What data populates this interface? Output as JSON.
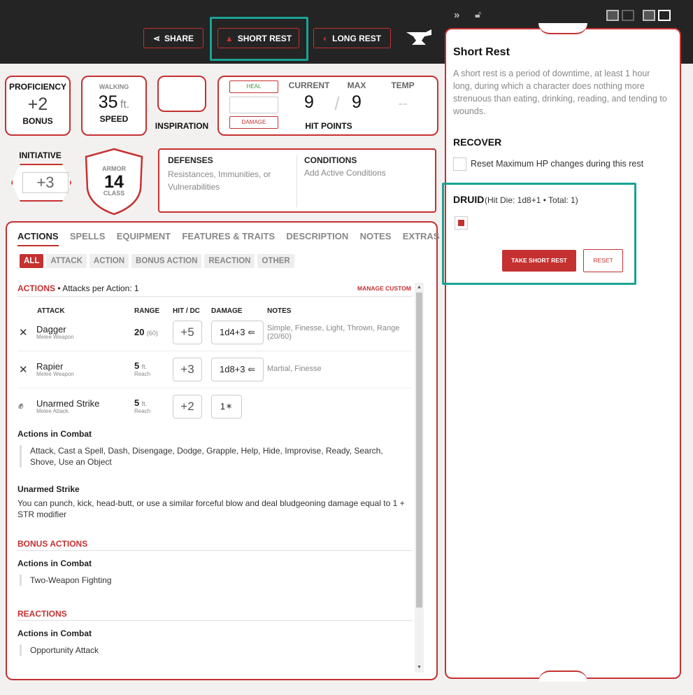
{
  "toolbar": {
    "share": "SHARE",
    "short_rest": "SHORT REST",
    "long_rest": "LONG REST"
  },
  "stats": {
    "proficiency_label": "PROFICIENCY",
    "proficiency_value": "+2",
    "proficiency_sub": "BONUS",
    "walking_label": "WALKING",
    "speed_value": "35",
    "speed_unit": "ft.",
    "speed_label": "SPEED",
    "inspiration_label": "INSPIRATION",
    "heal": "HEAL",
    "damage": "DAMAGE",
    "current_label": "CURRENT",
    "max_label": "MAX",
    "temp_label": "TEMP",
    "current": "9",
    "slash": "/",
    "max": "9",
    "temp": "--",
    "hp_label": "HIT POINTS",
    "initiative_label": "INITIATIVE",
    "initiative_value": "+3",
    "armor_label": "ARMOR",
    "armor_value": "14",
    "armor_class": "CLASS",
    "defenses_title": "DEFENSES",
    "defenses_text": "Resistances, Immunities, or Vulnerabilities",
    "conditions_title": "CONDITIONS",
    "conditions_text": "Add Active Conditions"
  },
  "tabs": [
    "ACTIONS",
    "SPELLS",
    "EQUIPMENT",
    "FEATURES & TRAITS",
    "DESCRIPTION",
    "NOTES",
    "EXTRAS"
  ],
  "filters": [
    "ALL",
    "ATTACK",
    "ACTION",
    "BONUS ACTION",
    "REACTION",
    "OTHER"
  ],
  "actions": {
    "title": "ACTIONS",
    "per_action": "• Attacks per Action: 1",
    "manage": "MANAGE CUSTOM",
    "headers": {
      "attack": "ATTACK",
      "range": "RANGE",
      "hit": "HIT / DC",
      "damage": "DAMAGE",
      "notes": "NOTES"
    },
    "rows": [
      {
        "name": "Dagger",
        "type": "Melee Weapon",
        "range": "20",
        "range_sub": "(60)",
        "hit": "+5",
        "damage": "1d4+3",
        "notes": "Simple, Finesse, Light, Thrown, Range (20/60)"
      },
      {
        "name": "Rapier",
        "type": "Melee Weapon",
        "range": "5",
        "range_unit": "ft.",
        "range_sub": "Reach",
        "hit": "+3",
        "damage": "1d8+3",
        "notes": "Martial, Finesse"
      },
      {
        "name": "Unarmed Strike",
        "type": "Melee Attack",
        "range": "5",
        "range_unit": "ft.",
        "range_sub": "Reach",
        "hit": "+2",
        "damage": "1",
        "notes": ""
      }
    ],
    "combat_title": "Actions in Combat",
    "combat_text": "Attack, Cast a Spell, Dash, Disengage, Dodge, Grapple, Help, Hide, Improvise, Ready, Search, Shove, Use an Object",
    "unarmed_title": "Unarmed Strike",
    "unarmed_text": "You can punch, kick, head-butt, or use a similar forceful blow and deal bludgeoning damage equal to 1 + STR modifier",
    "bonus_title": "BONUS ACTIONS",
    "bonus_sub": "Actions in Combat",
    "bonus_text": "Two-Weapon Fighting",
    "reactions_title": "REACTIONS",
    "reactions_sub": "Actions in Combat",
    "reactions_text": "Opportunity Attack"
  },
  "panel": {
    "title": "Short Rest",
    "description": "A short rest is a period of downtime, at least 1 hour long, during which a character does nothing more strenuous than eating, drinking, reading, and tending to wounds.",
    "recover_title": "RECOVER",
    "recover_option": "Reset Maximum HP changes during this rest",
    "class_name": "DRUID",
    "class_info": "(Hit Die: 1d8+1 • Total: 1)",
    "take_button": "TAKE SHORT REST",
    "reset_button": "RESET"
  },
  "colors": {
    "accent": "#c53131",
    "highlight": "#1aa394",
    "bar": "#242424"
  }
}
